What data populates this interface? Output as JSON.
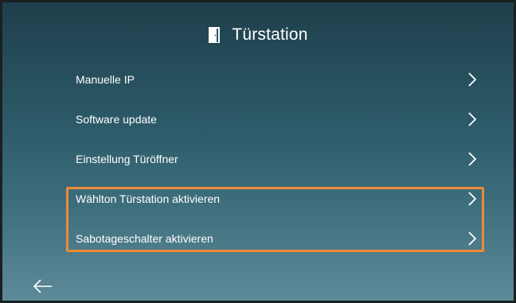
{
  "header": {
    "icon": "door-icon",
    "title": "Türstation"
  },
  "menu": {
    "items": [
      {
        "label": "Manuelle IP",
        "icon": "chevron-right-icon"
      },
      {
        "label": "Software update",
        "icon": "chevron-right-icon"
      },
      {
        "label": "Einstellung Türöffner",
        "icon": "chevron-right-icon"
      },
      {
        "label": "Wählton Türstation aktivieren",
        "icon": "chevron-right-icon"
      },
      {
        "label": "Sabotageschalter aktivieren",
        "icon": "chevron-right-icon"
      }
    ]
  },
  "footer": {
    "back_icon": "arrow-left-icon"
  },
  "colors": {
    "highlight_border": "#ee8a3a",
    "background_top": "#1f3f4c",
    "background_bottom": "#5d8a98",
    "text": "#ffffff"
  }
}
